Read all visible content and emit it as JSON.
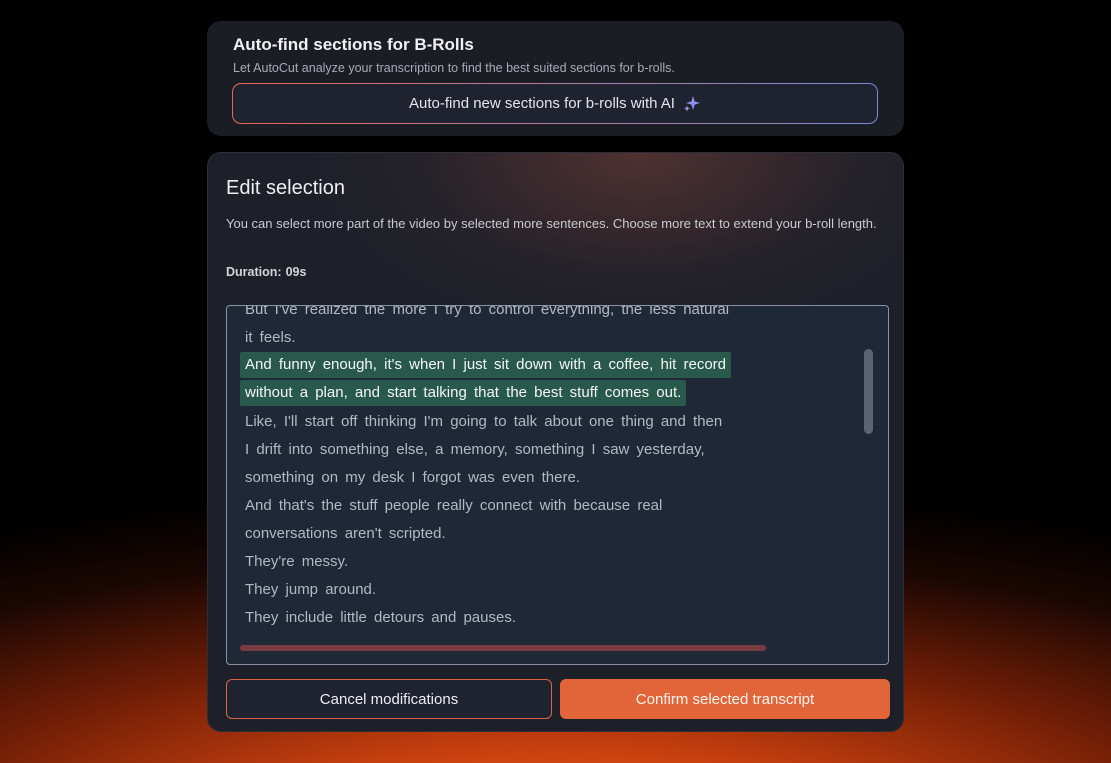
{
  "autofind": {
    "title": "Auto-find sections for B-Rolls",
    "subtitle": "Let AutoCut analyze your transcription to find the best suited sections for b-rolls.",
    "button_label": "Auto-find new sections for b-rolls with AI",
    "button_icon": "sparkle-icon"
  },
  "edit": {
    "title": "Edit selection",
    "description": "You can select more part of the video by selected more sentences. Choose more text to extend your b-roll length.",
    "duration_label": "Duration:",
    "duration_value": "09s",
    "transcript_lines": [
      "But I've realized the more I try to control everything, the less natural",
      "it feels.",
      "And funny enough, it's when I just sit down with a coffee, hit record",
      "without a plan, and start talking that the best stuff comes out.",
      "Like, I'll start off thinking I'm going to talk about one thing and then",
      "I drift into something else, a memory, something I saw yesterday,",
      "something on my desk I forgot was even there.",
      "And that's the stuff people really connect with because real",
      "conversations aren't scripted.",
      "They're messy.",
      "They jump around.",
      "They include little detours and pauses."
    ],
    "cancel_label": "Cancel modifications",
    "confirm_label": "Confirm selected transcript"
  },
  "colors": {
    "selection_highlight": "#29594a",
    "accent_orange": "#e2653a",
    "card_background": "#1e2029",
    "transcript_background": "#1f2837"
  }
}
